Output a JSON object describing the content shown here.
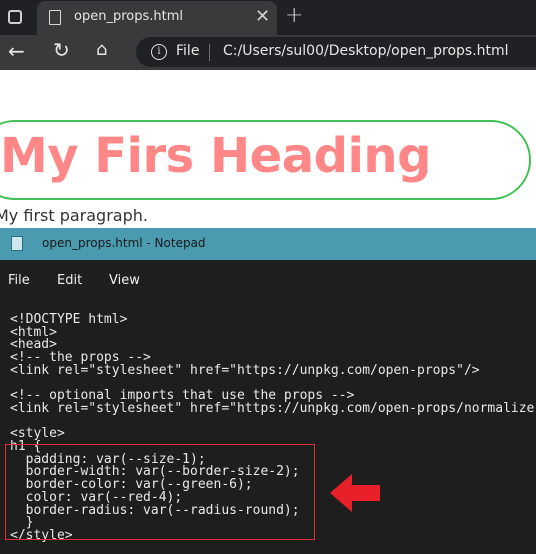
{
  "browser": {
    "tab_title": "open_props.html",
    "tab_close": "✕",
    "new_tab": "+",
    "address_scheme": "File",
    "address_url": "C:/Users/sul00/Desktop/open_props.html"
  },
  "page": {
    "heading": "My Firs Heading",
    "paragraph": "My first paragraph."
  },
  "notepad": {
    "title": "open_props.html - Notepad",
    "menu": [
      "File",
      "Edit",
      "View"
    ],
    "code": "<!DOCTYPE html>\n<html>\n<head>\n<!-- the props -->\n<link rel=\"stylesheet\" href=\"https://unpkg.com/open-props\"/>\n\n<!-- optional imports that use the props -->\n<link rel=\"stylesheet\" href=\"https://unpkg.com/open-props/normalize\n\n<style>\nh1 {\n  padding: var(--size-1);\n  border-width: var(--border-size-2);\n  border-color: var(--green-6);\n  color: var(--red-4);\n  border-radius: var(--radius-round);\n  }\n</style>"
  },
  "colors": {
    "heading_text": "#ff8787",
    "heading_border": "#40c057",
    "annotation": "#e03131",
    "notepad_titlebar": "#4a9bb0"
  }
}
